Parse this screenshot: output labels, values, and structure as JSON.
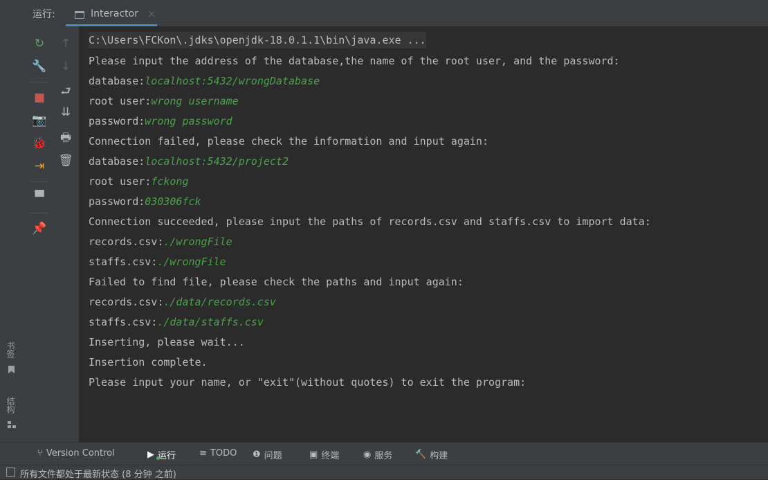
{
  "run_panel": {
    "label": "运行:",
    "tab": {
      "label": "Interactor",
      "close": "×"
    }
  },
  "toolbar_left": [
    {
      "name": "rerun-icon",
      "glyph": "↻",
      "color": "#59a869"
    },
    {
      "name": "wrench-icon",
      "glyph": "🔧",
      "color": "#afb1b3"
    },
    {
      "name": "stop-icon",
      "glyph": "■",
      "color": "#c75450"
    },
    {
      "name": "camera-icon",
      "glyph": "📷",
      "color": "#afb1b3"
    },
    {
      "name": "debug-bug-icon",
      "glyph": "🐞",
      "color": "#59a869"
    },
    {
      "name": "exit-icon",
      "glyph": "⇥",
      "color": "#e8a33d"
    },
    {
      "name": "layout-icon",
      "glyph": "▀",
      "color": "#afb1b3"
    },
    {
      "name": "pin-icon",
      "glyph": "📌",
      "color": "#afb1b3"
    }
  ],
  "toolbar_right": [
    {
      "name": "up-arrow-icon",
      "glyph": "↑",
      "color": "#5e6266"
    },
    {
      "name": "down-arrow-icon",
      "glyph": "↓",
      "color": "#5e6266"
    },
    {
      "name": "soft-wrap-icon",
      "glyph": "⮐",
      "color": "#afb1b3"
    },
    {
      "name": "scroll-to-end-icon",
      "glyph": "⇊",
      "color": "#afb1b3"
    },
    {
      "name": "print-icon",
      "glyph": "🖶",
      "color": "#afb1b3"
    },
    {
      "name": "trash-icon",
      "glyph": "🗑",
      "color": "#afb1b3"
    }
  ],
  "side_tabs": {
    "bookmarks": "书签",
    "structure": "结构"
  },
  "console": [
    {
      "text": "C:\\Users\\FCKon\\.jdks\\openjdk-18.0.1.1\\bin\\java.exe ...",
      "input": ""
    },
    {
      "text": "Please input the address of the database,the name of the root user, and the password:",
      "input": ""
    },
    {
      "text": "database:",
      "input": "localhost:5432/wrongDatabase"
    },
    {
      "text": "root user:",
      "input": "wrong username"
    },
    {
      "text": "password:",
      "input": "wrong password"
    },
    {
      "text": "Connection failed, please check the information and input again:",
      "input": ""
    },
    {
      "text": "database:",
      "input": "localhost:5432/project2"
    },
    {
      "text": "root user:",
      "input": "fckong"
    },
    {
      "text": "password:",
      "input": "030306fck"
    },
    {
      "text": "Connection succeeded, please input the paths of records.csv and staffs.csv to import data:",
      "input": ""
    },
    {
      "text": "records.csv:",
      "input": "./wrongFile"
    },
    {
      "text": "staffs.csv:",
      "input": "./wrongFile"
    },
    {
      "text": "Failed to find file, please check the paths and input again:",
      "input": ""
    },
    {
      "text": "records.csv:",
      "input": "./data/records.csv"
    },
    {
      "text": "staffs.csv:",
      "input": "./data/staffs.csv"
    },
    {
      "text": "Inserting, please wait...",
      "input": ""
    },
    {
      "text": "Insertion complete.",
      "input": ""
    },
    {
      "text": "Please input your name, or \"exit\"(without quotes) to exit the program:",
      "input": ""
    }
  ],
  "bottom_tabs": [
    {
      "name": "version-control",
      "icon": "version-control-icon",
      "glyph": "⑂",
      "label": "Version Control"
    },
    {
      "name": "run",
      "icon": "run-icon",
      "glyph": "▶",
      "label": "运行"
    },
    {
      "name": "todo",
      "icon": "list-icon",
      "glyph": "≡",
      "label": "TODO"
    },
    {
      "name": "problems",
      "icon": "info-icon",
      "glyph": "❶",
      "label": "问题"
    },
    {
      "name": "terminal",
      "icon": "terminal-icon",
      "glyph": "▣",
      "label": "终端"
    },
    {
      "name": "services",
      "icon": "services-icon",
      "glyph": "◉",
      "label": "服务"
    },
    {
      "name": "build",
      "icon": "hammer-icon",
      "glyph": "🔨",
      "label": "构建"
    }
  ],
  "status": {
    "text": "所有文件都处于最新状态 (8 分钟 之前)"
  },
  "colors": {
    "background": "#2b2b2b",
    "panel": "#3c3f41",
    "user_input": "#4aa14a",
    "accent": "#4a88c7"
  }
}
